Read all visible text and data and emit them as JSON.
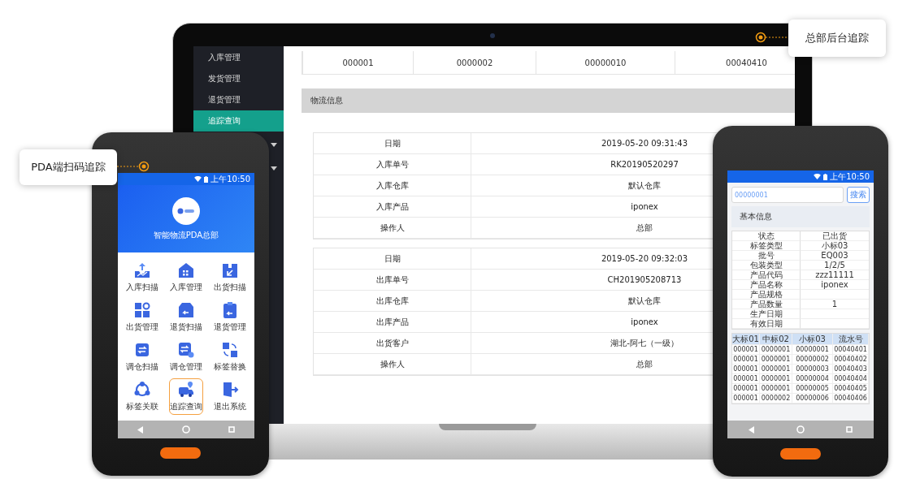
{
  "pda_callout": {
    "text": "PDA端扫码追踪"
  },
  "admin_callout": {
    "text": "总部后台追踪"
  },
  "laptop": {
    "sidebar": [
      {
        "label": "入库管理",
        "selected": false
      },
      {
        "label": "发货管理",
        "selected": false
      },
      {
        "label": "退货管理",
        "selected": false
      },
      {
        "label": "追踪查询",
        "selected": true
      }
    ],
    "top_row": [
      "000001",
      "0000002",
      "00000010",
      "00040410"
    ],
    "section_title": "物流信息",
    "tables": [
      [
        {
          "label": "日期",
          "value": "2019-05-20 09:31:43"
        },
        {
          "label": "入库单号",
          "value": "RK20190520297"
        },
        {
          "label": "入库仓库",
          "value": "默认仓库"
        },
        {
          "label": "入库产品",
          "value": "iponex"
        },
        {
          "label": "操作人",
          "value": "总部"
        }
      ],
      [
        {
          "label": "日期",
          "value": "2019-05-20 09:32:03"
        },
        {
          "label": "出库单号",
          "value": "CH201905208713"
        },
        {
          "label": "出库仓库",
          "value": "默认仓库"
        },
        {
          "label": "出库产品",
          "value": "iponex"
        },
        {
          "label": "出货客户",
          "value": "湖北-阿七（一级）"
        },
        {
          "label": "操作人",
          "value": "总部"
        }
      ]
    ]
  },
  "pda": {
    "status_time": "上午10:50",
    "title": "智能物流PDA总部",
    "menu": [
      {
        "label": "入库扫描",
        "selected": false
      },
      {
        "label": "入库管理",
        "selected": false
      },
      {
        "label": "出货扫描",
        "selected": false
      },
      {
        "label": "出货管理",
        "selected": false
      },
      {
        "label": "退货扫描",
        "selected": false
      },
      {
        "label": "退货管理",
        "selected": false
      },
      {
        "label": "调仓扫描",
        "selected": false
      },
      {
        "label": "调仓管理",
        "selected": false
      },
      {
        "label": "标签替换",
        "selected": false
      },
      {
        "label": "标签关联",
        "selected": false
      },
      {
        "label": "追踪查询",
        "selected": true
      },
      {
        "label": "退出系统",
        "selected": false
      }
    ]
  },
  "scanner": {
    "status_time": "上午10:50",
    "search": {
      "value": "00000001"
    },
    "search_button": "搜索",
    "section_title": "基本信息",
    "info": [
      {
        "label": "状态",
        "value": "已出货"
      },
      {
        "label": "标签类型",
        "value": "小标03"
      },
      {
        "label": "批号",
        "value": "EQ003"
      },
      {
        "label": "包装类型",
        "value": "1/2/5"
      },
      {
        "label": "产品代码",
        "value": "zzz11111"
      },
      {
        "label": "产品名称",
        "value": "iponex"
      },
      {
        "label": "产品规格"
      },
      {
        "label": "产品数量",
        "value": "1"
      },
      {
        "label": "生产日期"
      },
      {
        "label": "有效日期"
      }
    ],
    "grid": {
      "columns": [
        "大标01",
        "中标02",
        "小标03",
        "流水号"
      ],
      "rows": [
        [
          "000001",
          "0000001",
          "00000001",
          "00040401"
        ],
        [
          "000001",
          "0000001",
          "00000002",
          "00040402"
        ],
        [
          "000001",
          "0000001",
          "00000003",
          "00040403"
        ],
        [
          "000001",
          "0000001",
          "00000004",
          "00040404"
        ],
        [
          "000001",
          "0000001",
          "00000005",
          "00040405"
        ],
        [
          "000001",
          "0000002",
          "00000006",
          "00040406"
        ]
      ]
    }
  }
}
